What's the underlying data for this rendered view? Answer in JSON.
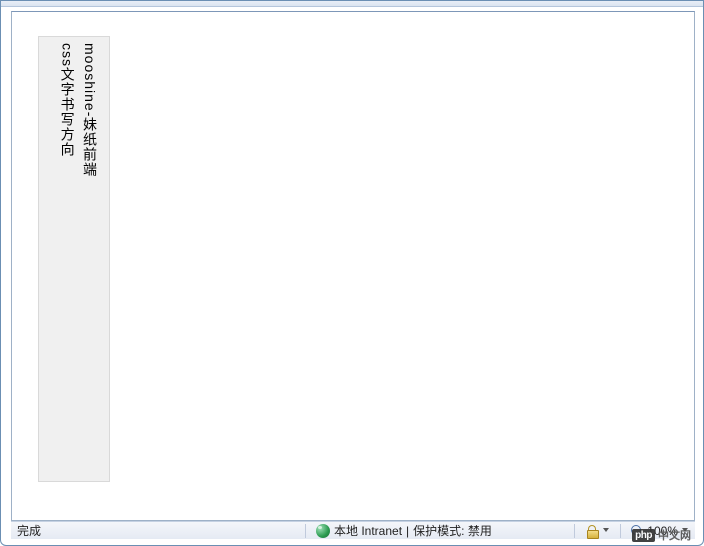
{
  "content": {
    "vertical_text_line1": "mooshine-妹纸前端",
    "vertical_text_line2": "css文字书写方向"
  },
  "status": {
    "done": "完成",
    "zone": "本地 Intranet",
    "protected_mode": "保护模式: 禁用",
    "zoom": "100%"
  },
  "watermark": {
    "logo": "php",
    "text": "中文网"
  }
}
